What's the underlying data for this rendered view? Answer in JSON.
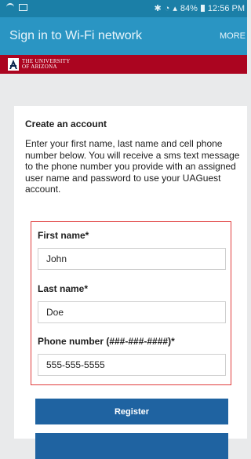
{
  "status_bar": {
    "battery": "84%",
    "time": "12:56 PM"
  },
  "app_bar": {
    "title": "Sign in to Wi-Fi network",
    "more_label": "MORE"
  },
  "brand": {
    "line1": "THE UNIVERSITY",
    "line2": "OF ARIZONA"
  },
  "card": {
    "title": "Create an account",
    "intro": "Enter your first name, last name and cell phone number below.  You will receive a sms text message to the phone number you provide with an assigned user name and password to use your UAGuest account."
  },
  "form": {
    "first_name_label": "First name*",
    "first_name_value": "John",
    "last_name_label": "Last name*",
    "last_name_value": "Doe",
    "phone_label": "Phone number (###-###-####)*",
    "phone_value": "555-555-5555"
  },
  "buttons": {
    "register_label": "Register"
  },
  "colors": {
    "status_bar": "#1b7fa7",
    "app_bar": "#2a95c3",
    "brand_red": "#ab0520",
    "button_blue": "#1f63a1",
    "form_outline": "#e03d3d"
  }
}
